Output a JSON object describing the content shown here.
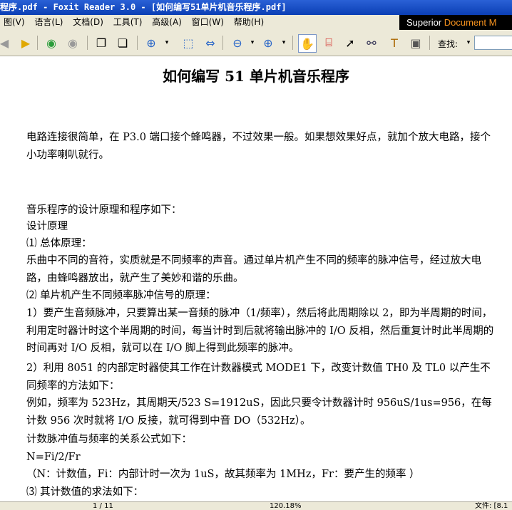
{
  "window": {
    "title": "程序.pdf - Foxit Reader 3.0 - [如何编写51单片机音乐程序.pdf]"
  },
  "menu": {
    "items": [
      "图(V)",
      "语言(L)",
      "文档(D)",
      "工具(T)",
      "高级(A)",
      "窗口(W)",
      "帮助(H)"
    ],
    "brand_prefix": "Superior ",
    "brand_accent": "Document M"
  },
  "toolbar": {
    "find_label": "查找:",
    "icons": [
      "back-arrow-icon",
      "forward-arrow-icon",
      "green-back-icon",
      "gray-forward-icon",
      "copy-page-icon",
      "paste-page-icon",
      "zoom-in-icon",
      "fit-page-icon",
      "fit-width-icon",
      "zoom-out-icon",
      "zoom-plus-icon",
      "hand-tool-icon",
      "snapshot-glasses-icon",
      "select-arrow-icon",
      "binoculars-icon",
      "text-select-icon",
      "camera-icon"
    ]
  },
  "document": {
    "title": "如何编写 51 单片机音乐程序",
    "paragraphs": [
      "电路连接很简单，在 P3.0 端口接个蜂鸣器，不过效果一般。如果想效果好点，就加个放大电路，接个小功率喇叭就行。",
      "音乐程序的设计原理和程序如下：",
      "设计原理",
      "⑴ 总体原理：",
      " 乐曲中不同的音符，实质就是不同频率的声音。通过单片机产生不同的频率的脉冲信号，经过放大电路，由蜂鸣器放出，就产生了美妙和谐的乐曲。",
      "⑵ 单片机产生不同频率脉冲信号的原理：",
      "1）要产生音频脉冲，只要算出某一音频的脉冲（1/频率），然后将此周期除以 2，即为半周期的时间，利用定时器计时这个半周期的时间，每当计时到后就将输出脉冲的 I/O 反相，然后重复计时此半周期的时间再对 I/O 反相，就可以在 I/O 脚上得到此频率的脉冲。",
      "2）利用 8051 的内部定时器使其工作在计数器模式 MODE1 下，改变计数值 TH0 及 TL0 以产生不同频率的方法如下：",
      "    例如，频率为 523Hz，其周期天/523 S=1912uS，因此只要令计数器计时 956uS/1us=956，在每计数 956 次时就将 I/O 反接，就可得到中音 DO（532Hz）。",
      "计数脉冲值与频率的关系公式如下：",
      "N=Fi/2/Fr",
      "（N：计数值，Fi：内部计时一次为 1uS，故其频率为 1MHz，Fr：要产生的频率 ）",
      "⑶ 其计数值的求法如下："
    ]
  },
  "status": {
    "page": "1 / 11",
    "zoom": "120.18%",
    "file_label": "文件: [8.1"
  }
}
